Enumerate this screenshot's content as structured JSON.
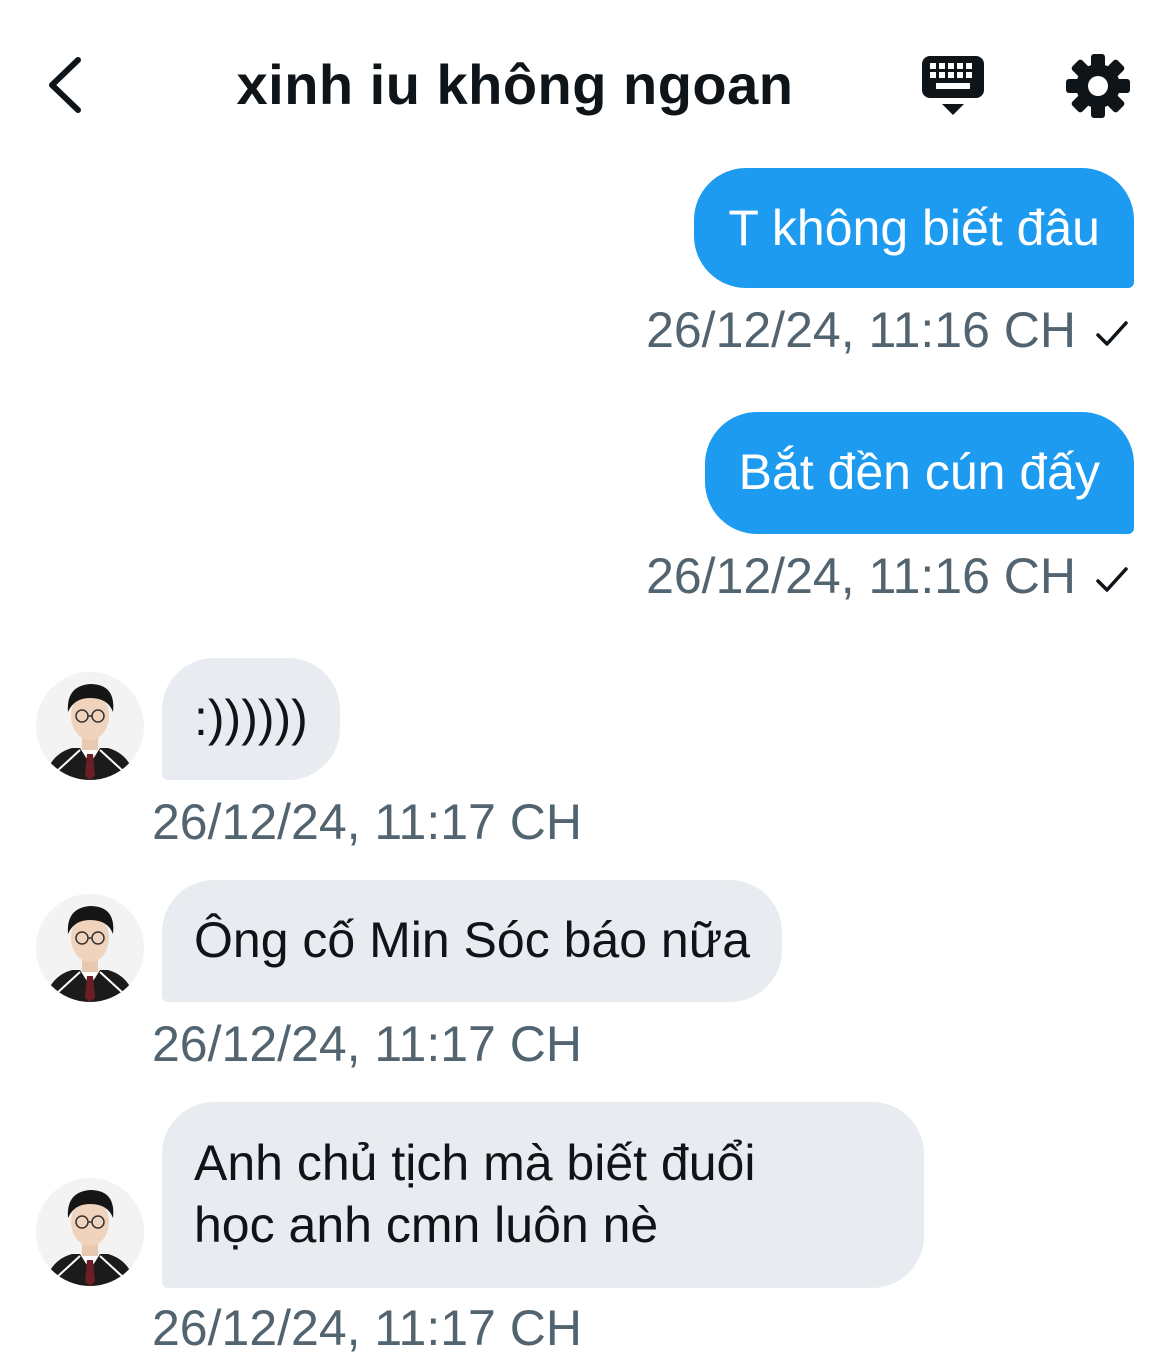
{
  "header": {
    "title": "xinh iu không ngoan",
    "back_icon": "chevron-left-icon",
    "keyboard_icon": "keyboard-icon",
    "settings_icon": "gear-icon"
  },
  "messages": [
    {
      "direction": "outgoing",
      "text": "T không biết đâu",
      "timestamp": "26/12/24, 11:16 CH",
      "status_icon": "checkmark-icon"
    },
    {
      "direction": "outgoing",
      "text": "Bắt đền cún đấy",
      "timestamp": "26/12/24, 11:16 CH",
      "status_icon": "checkmark-icon"
    },
    {
      "direction": "incoming",
      "text": ":))))))",
      "timestamp": "26/12/24, 11:17 CH"
    },
    {
      "direction": "incoming",
      "text": "Ông cố Min Sóc báo nữa",
      "timestamp": "26/12/24, 11:17 CH"
    },
    {
      "direction": "incoming",
      "text_lines": [
        "Anh chủ tịch mà biết đuổi",
        "học anh cmn luôn nè"
      ],
      "timestamp": "26/12/24, 11:17 CH"
    }
  ],
  "colors": {
    "outgoing_bubble": "#1d9bf0",
    "incoming_bubble": "#e8ebef",
    "timestamp": "#536471",
    "text": "#0f1419"
  }
}
